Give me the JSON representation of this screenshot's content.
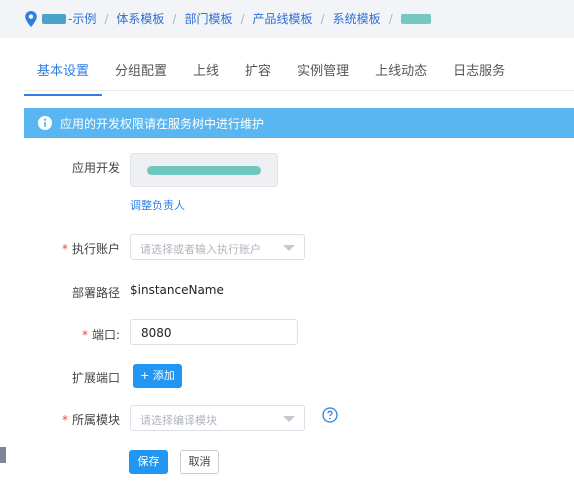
{
  "breadcrumb": {
    "items": [
      "-示例",
      "体系模板",
      "部门模板",
      "产品线模板",
      "系统模板"
    ],
    "separator": "/",
    "icon": "location-pin-icon"
  },
  "tabs": [
    {
      "label": "基本设置",
      "active": true
    },
    {
      "label": "分组配置",
      "active": false
    },
    {
      "label": "上线",
      "active": false
    },
    {
      "label": "扩容",
      "active": false
    },
    {
      "label": "实例管理",
      "active": false
    },
    {
      "label": "上线动态",
      "active": false
    },
    {
      "label": "日志服务",
      "active": false
    }
  ],
  "alert": {
    "text": "应用的开发权限请在服务树中进行维护",
    "icon": "info-circle-icon"
  },
  "form": {
    "developer": {
      "label": "应用开发",
      "link": "调整负责人"
    },
    "account": {
      "label": "执行账户",
      "required_mark": "*",
      "placeholder": "请选择或者输入执行账户"
    },
    "deploy_path": {
      "label": "部署路径",
      "value": "$instanceName"
    },
    "port": {
      "label": "端口:",
      "required_mark": "*",
      "value": "8080"
    },
    "ext_port": {
      "label": "扩展端口",
      "add_button": "+ 添加"
    },
    "module": {
      "label": "所属模块",
      "required_mark": "*",
      "placeholder": "请选择编译模块",
      "help_icon": "question-circle-icon"
    }
  },
  "actions": {
    "save": "保存",
    "cancel": "取消"
  },
  "colors": {
    "primary": "#2196f3",
    "alert_bg": "#5ab6f0",
    "required": "#e74c3c"
  }
}
